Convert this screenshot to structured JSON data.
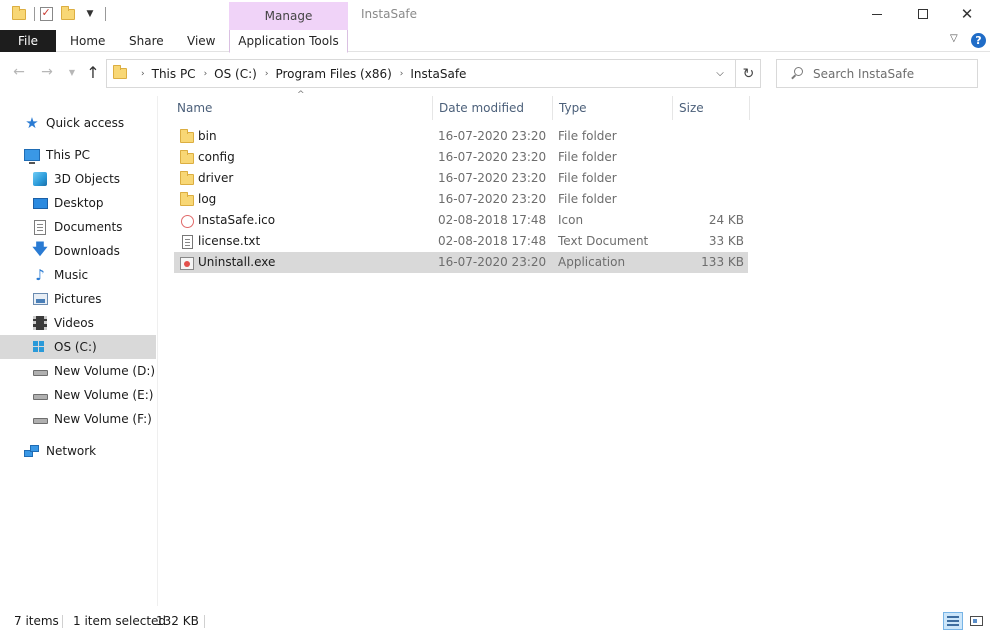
{
  "window": {
    "title": "InstaSafe",
    "context_tab_group": "Manage"
  },
  "ribbon": {
    "tabs": [
      {
        "label": "File"
      },
      {
        "label": "Home"
      },
      {
        "label": "Share"
      },
      {
        "label": "View"
      },
      {
        "label": "Application Tools"
      }
    ]
  },
  "address": {
    "crumbs": [
      "This PC",
      "OS (C:)",
      "Program Files (x86)",
      "InstaSafe"
    ]
  },
  "search": {
    "placeholder": "Search InstaSafe"
  },
  "nav": {
    "items": [
      {
        "label": "Quick access",
        "icon": "star-icon"
      },
      {
        "label": "This PC",
        "icon": "computer-icon"
      },
      {
        "label": "3D Objects",
        "icon": "3d-objects-icon"
      },
      {
        "label": "Desktop",
        "icon": "desktop-icon"
      },
      {
        "label": "Documents",
        "icon": "documents-icon"
      },
      {
        "label": "Downloads",
        "icon": "downloads-icon"
      },
      {
        "label": "Music",
        "icon": "music-icon"
      },
      {
        "label": "Pictures",
        "icon": "pictures-icon"
      },
      {
        "label": "Videos",
        "icon": "videos-icon"
      },
      {
        "label": "OS (C:)",
        "icon": "os-drive-icon",
        "selected": true
      },
      {
        "label": "New Volume (D:)",
        "icon": "drive-icon"
      },
      {
        "label": "New Volume (E:)",
        "icon": "drive-icon"
      },
      {
        "label": "New Volume (F:)",
        "icon": "drive-icon"
      },
      {
        "label": "Network",
        "icon": "network-icon"
      }
    ]
  },
  "files": {
    "columns": [
      "Name",
      "Date modified",
      "Type",
      "Size"
    ],
    "rows": [
      {
        "name": "bin",
        "date": "16-07-2020 23:20",
        "type": "File folder",
        "size": "",
        "icon": "folder-icon"
      },
      {
        "name": "config",
        "date": "16-07-2020 23:20",
        "type": "File folder",
        "size": "",
        "icon": "folder-icon"
      },
      {
        "name": "driver",
        "date": "16-07-2020 23:20",
        "type": "File folder",
        "size": "",
        "icon": "folder-icon"
      },
      {
        "name": "log",
        "date": "16-07-2020 23:20",
        "type": "File folder",
        "size": "",
        "icon": "folder-icon"
      },
      {
        "name": "InstaSafe.ico",
        "date": "02-08-2018 17:48",
        "type": "Icon",
        "size": "24 KB",
        "icon": "ico-file-icon"
      },
      {
        "name": "license.txt",
        "date": "02-08-2018 17:48",
        "type": "Text Document",
        "size": "33 KB",
        "icon": "text-file-icon"
      },
      {
        "name": "Uninstall.exe",
        "date": "16-07-2020 23:20",
        "type": "Application",
        "size": "133 KB",
        "icon": "exe-file-icon",
        "selected": true
      }
    ]
  },
  "status": {
    "items": "7 items",
    "selected": "1 item selected",
    "size": "132 KB"
  },
  "colors": {
    "manage_tab": "#f0d3f8",
    "file_tab": "#1d1d1d",
    "selection": "#d9d9d9",
    "help": "#1f6cc7"
  }
}
